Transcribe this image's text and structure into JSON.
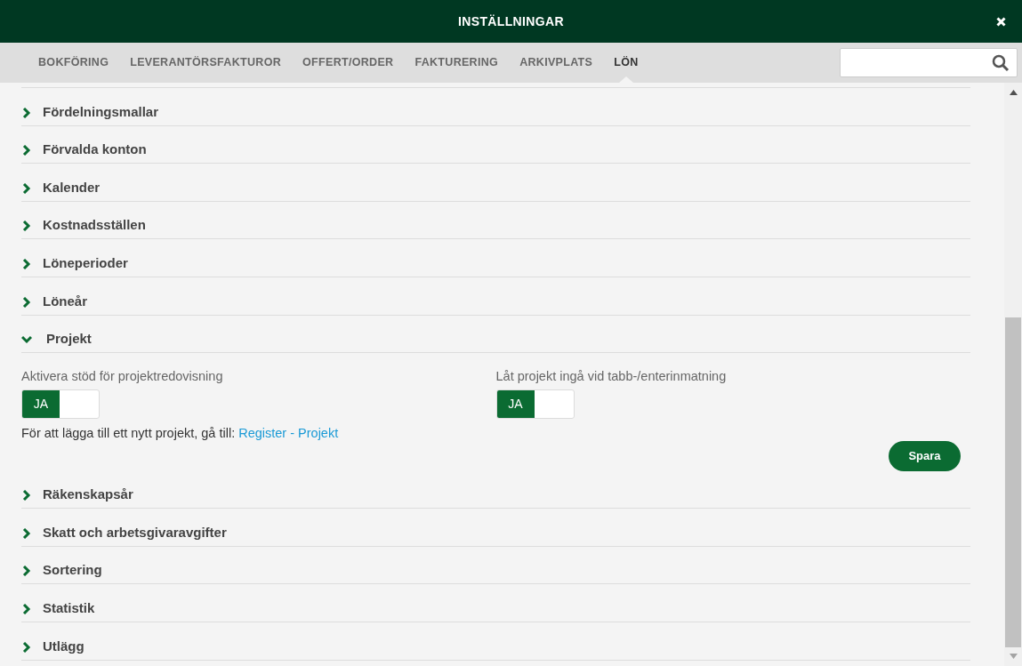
{
  "window": {
    "title": "INSTÄLLNINGAR"
  },
  "tabs": [
    {
      "label": "BOKFÖRING",
      "selected": false
    },
    {
      "label": "LEVERANTÖRSFAKTUROR",
      "selected": false
    },
    {
      "label": "OFFERT/ORDER",
      "selected": false
    },
    {
      "label": "FAKTURERING",
      "selected": false
    },
    {
      "label": "ARKIVPLATS",
      "selected": false
    },
    {
      "label": "LÖN",
      "selected": true
    }
  ],
  "sections": [
    {
      "title": "Fördelningsmallar",
      "expanded": false
    },
    {
      "title": "Förvalda konton",
      "expanded": false
    },
    {
      "title": "Kalender",
      "expanded": false
    },
    {
      "title": "Kostnadsställen",
      "expanded": false
    },
    {
      "title": "Löneperioder",
      "expanded": false
    },
    {
      "title": "Löneår",
      "expanded": false
    },
    {
      "title": "Projekt",
      "expanded": true,
      "settings": [
        {
          "label": "Aktivera stöd för projektredovisning",
          "toggle": "JA",
          "on": true
        },
        {
          "label": "Låt projekt ingå vid tabb-/enterinmatning",
          "toggle": "JA",
          "on": true
        }
      ],
      "note": "För att lägga till ett nytt projekt, gå till:",
      "link": "Register - Projekt",
      "button": "Spara"
    },
    {
      "title": "Räkenskapsår",
      "expanded": false
    },
    {
      "title": "Skatt och arbetsgivaravgifter",
      "expanded": false
    },
    {
      "title": "Sortering",
      "expanded": false
    },
    {
      "title": "Statistik",
      "expanded": false
    },
    {
      "title": "Utlägg",
      "expanded": false
    }
  ]
}
